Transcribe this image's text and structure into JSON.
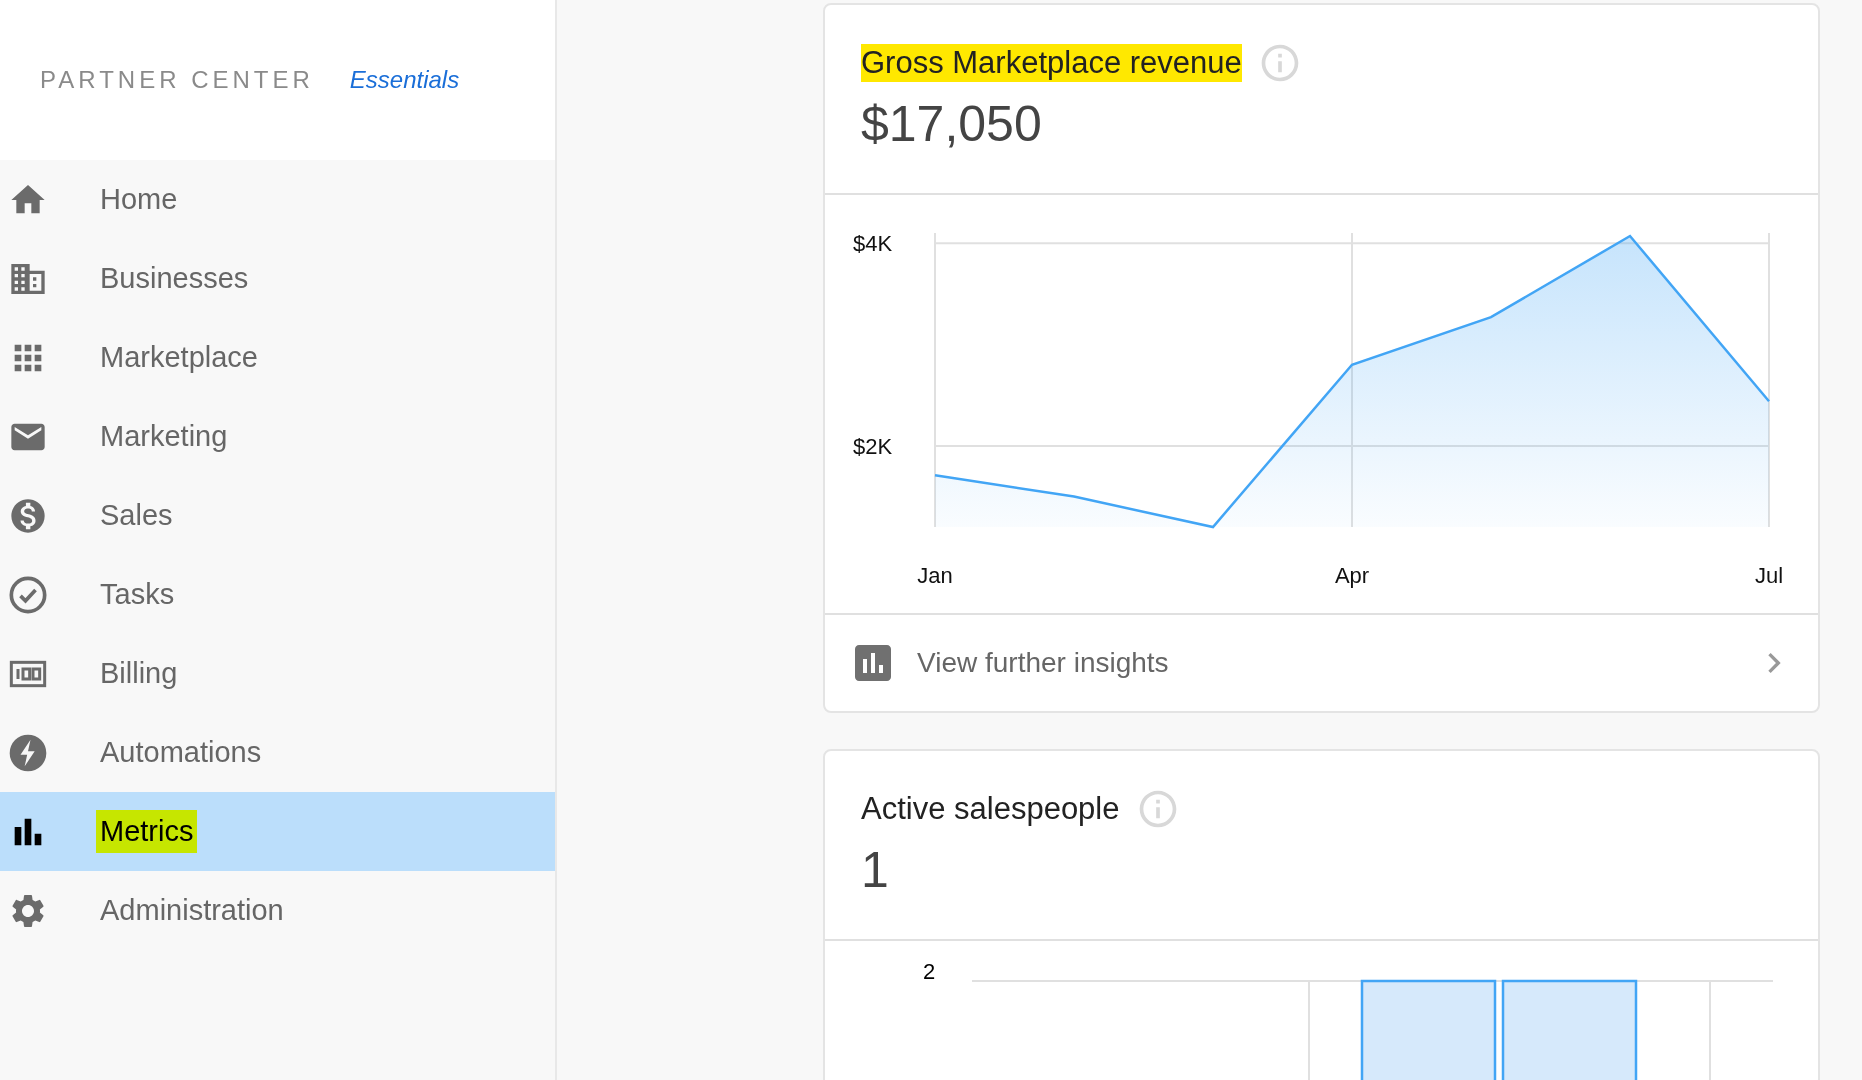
{
  "sidebar": {
    "brand": "PARTNER CENTER",
    "edition": "Essentials",
    "items": [
      {
        "label": "Home",
        "selected": false,
        "highlighted": false
      },
      {
        "label": "Businesses",
        "selected": false,
        "highlighted": false
      },
      {
        "label": "Marketplace",
        "selected": false,
        "highlighted": false
      },
      {
        "label": "Marketing",
        "selected": false,
        "highlighted": false
      },
      {
        "label": "Sales",
        "selected": false,
        "highlighted": false
      },
      {
        "label": "Tasks",
        "selected": false,
        "highlighted": false
      },
      {
        "label": "Billing",
        "selected": false,
        "highlighted": false
      },
      {
        "label": "Automations",
        "selected": false,
        "highlighted": false
      },
      {
        "label": "Metrics",
        "selected": true,
        "highlighted": true
      },
      {
        "label": "Administration",
        "selected": false,
        "highlighted": false
      }
    ]
  },
  "cards": [
    {
      "kind": "line",
      "title": "Gross Marketplace revenue",
      "title_highlighted": true,
      "value": "$17,050",
      "chart_data": {
        "type": "area",
        "grid": true,
        "categories": [
          "Jan",
          null,
          null,
          "Apr",
          null,
          null,
          "Jul"
        ],
        "series": [
          {
            "color": "#42a5f5",
            "values": [
              1710,
              1500,
              1200,
              2800,
              3270,
              4070,
              2440
            ]
          }
        ],
        "ylim": [
          1200,
          4100
        ],
        "yticks": [
          {
            "value": 2000,
            "label": "$2K"
          },
          {
            "value": 4000,
            "label": "$4K"
          }
        ]
      },
      "footer_link": "View further insights"
    },
    {
      "kind": "bar",
      "title": "Active salespeople",
      "title_highlighted": false,
      "value": "1",
      "tick_label": "2"
    }
  ]
}
